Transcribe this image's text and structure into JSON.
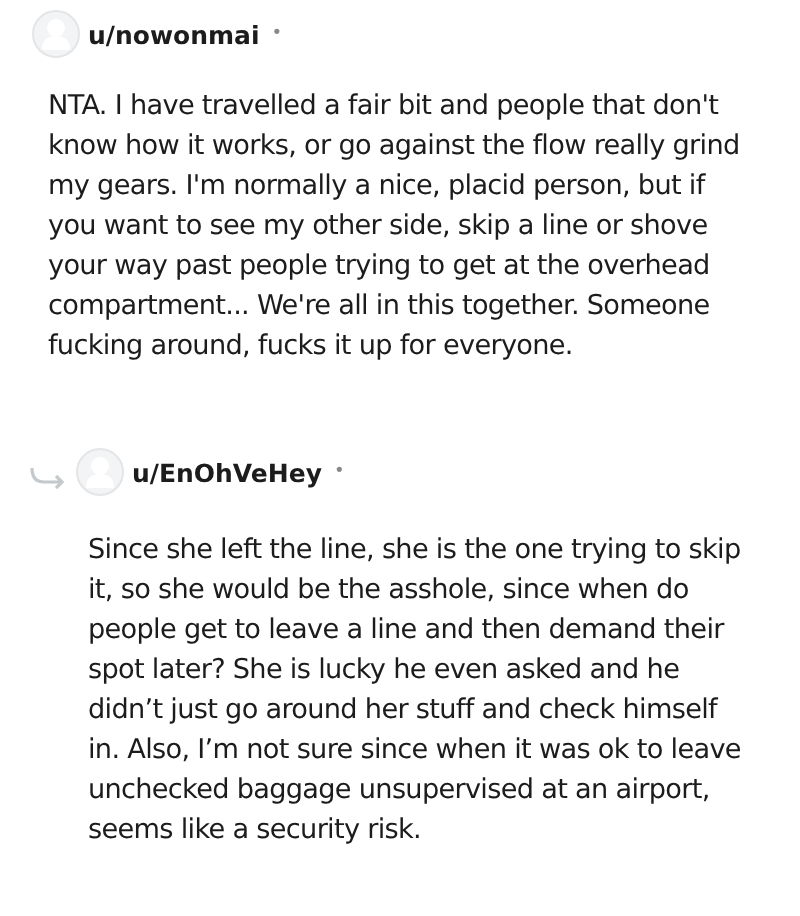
{
  "comments": [
    {
      "username": "u/nowonmai",
      "separator": "•",
      "is_reply": false,
      "body": "NTA. I have travelled a fair bit and people that don't know how it works, or go against the flow really grind my gears. I'm normally a nice, placid person, but if you want to see my other side, skip a line or shove your way past people trying to get at the overhead compartment... We're all in this together. Someone fucking around, fucks it up for everyone."
    },
    {
      "username": "u/EnOhVeHey",
      "separator": "•",
      "is_reply": true,
      "body": "Since she left the line, she is the one trying to skip it, so she would be the asshole, since when do people get to leave a line and then demand their spot later? She is lucky he even asked and he didn’t just go around her stuff and check himself in. Also, I’m not sure since when it was ok to leave unchecked baggage unsupervised at an airport, seems like a security risk."
    }
  ]
}
